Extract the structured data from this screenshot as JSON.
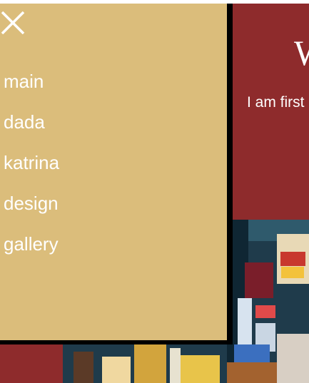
{
  "hero": {
    "heading": "W",
    "text": "I am first"
  },
  "drawer": {
    "close_icon": "close-icon",
    "nav": [
      "main",
      "dada",
      "katrina",
      "design",
      "gallery"
    ]
  },
  "colors": {
    "page_background": "#8e2b2c",
    "drawer_background": "#dbbd7b",
    "drawer_shadow": "#000000",
    "text": "#ffffff"
  }
}
